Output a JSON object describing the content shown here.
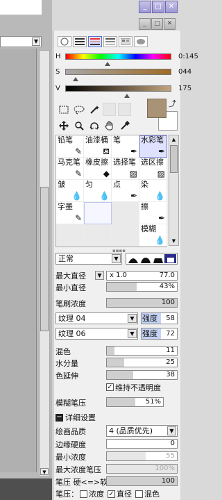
{
  "window": {
    "minimize_label": "_",
    "maximize_label": "□",
    "close_label": "✕",
    "inner_minimize_label": "_",
    "inner_maximize_label": "□",
    "inner_close_label": "✕"
  },
  "colors": {
    "accent": "#7f88d6",
    "main_color": "#a99377",
    "sub_color": "#ffffff"
  },
  "color_panel": {
    "sliders": [
      {
        "letter": "H",
        "value": "0:145",
        "position": 0.4
      },
      {
        "letter": "S",
        "value": "044",
        "position": 0.09
      },
      {
        "letter": "V",
        "value": "175",
        "position": 0.58
      }
    ]
  },
  "brushes": [
    {
      "name": "铅笔",
      "icon": "pencil-icon",
      "glyph": "✎"
    },
    {
      "name": "油漆桶",
      "icon": "bucket-icon",
      "glyph": "⛾"
    },
    {
      "name": "笔",
      "icon": "pen-icon",
      "glyph": "✒"
    },
    {
      "name": "水彩笔",
      "icon": "watercolor-icon",
      "glyph": "✒",
      "selected": true
    },
    {
      "name": "马克笔",
      "icon": "marker-icon",
      "glyph": "✎"
    },
    {
      "name": "橡皮擦",
      "icon": "eraser-icon",
      "glyph": "◆"
    },
    {
      "name": "选择笔",
      "icon": "select-pen-icon",
      "glyph": "▨"
    },
    {
      "name": "选区擦",
      "icon": "select-erase-icon",
      "glyph": "▨"
    },
    {
      "name": "皱",
      "icon": "wrinkle-icon",
      "glyph": "💧"
    },
    {
      "name": "匀",
      "icon": "blend-icon",
      "glyph": "💧"
    },
    {
      "name": "点",
      "icon": "dot-icon",
      "glyph": "✒"
    },
    {
      "name": "染",
      "icon": "dye-icon",
      "glyph": "💧"
    },
    {
      "name": "字墨",
      "icon": "ink-icon",
      "glyph": "✎"
    },
    {
      "name": "",
      "icon": "",
      "glyph": "",
      "empty_blue": true
    },
    {
      "name": "",
      "icon": "",
      "glyph": "",
      "grey": true
    },
    {
      "name": "擦",
      "icon": "rub-icon",
      "glyph": "✒"
    },
    {
      "name": "",
      "icon": "",
      "glyph": "",
      "grey": true
    },
    {
      "name": "",
      "icon": "",
      "glyph": "",
      "grey": true
    },
    {
      "name": "",
      "icon": "",
      "glyph": "",
      "grey": true
    },
    {
      "name": "模糊",
      "icon": "blur-icon",
      "glyph": "💧"
    }
  ],
  "blend_mode": "正常",
  "settings": {
    "max_size_label": "最大直径",
    "max_size_multiplier": "x 1.0",
    "max_size_value": "77.0",
    "min_size_label": "最小直径",
    "min_size_value": "43%",
    "min_size_fraction": 0.43,
    "density_label": "笔刷浓度",
    "density_value": "100",
    "density_fraction": 1.0,
    "texture1": "纹理 04",
    "texture1_strength_label": "强度",
    "texture1_strength": "58",
    "texture2": "纹理 06",
    "texture2_strength_label": "强度",
    "texture2_strength": "72",
    "mix_label": "混色",
    "mix_value": "11",
    "mix_fraction": 0.11,
    "water_label": "水分量",
    "water_value": "25",
    "water_fraction": 0.25,
    "extend_label": "色延伸",
    "extend_value": "38",
    "extend_fraction": 0.38,
    "keep_opacity_label": "维持不透明度",
    "keep_opacity_checked": true,
    "blur_pressure_label": "模糊笔压",
    "blur_pressure_value": "51%",
    "blur_pressure_fraction": 0.51,
    "advanced_label": "详细设置",
    "quality_label": "绘画品质",
    "quality_value": "4 (品质优先)",
    "edge_hardness_label": "边缘硬度",
    "edge_hardness_value": "0",
    "edge_hardness_fraction": 0.0,
    "min_density_label": "最小浓度",
    "min_density_value": "55",
    "min_density_fraction": 0.55,
    "max_density_pressure_label": "最大浓度笔压",
    "max_density_pressure_value": "100%",
    "max_density_pressure_fraction": 1.0,
    "pressure_hardness_label": "笔压 硬<=>软",
    "pressure_hardness_value": "100",
    "pressure_hardness_fraction": 1.0
  },
  "pressure_row": {
    "label": "笔压：",
    "density_label": "浓度",
    "density_checked": false,
    "size_label": "直径",
    "size_checked": true,
    "mix_label": "混色",
    "mix_checked": false
  }
}
